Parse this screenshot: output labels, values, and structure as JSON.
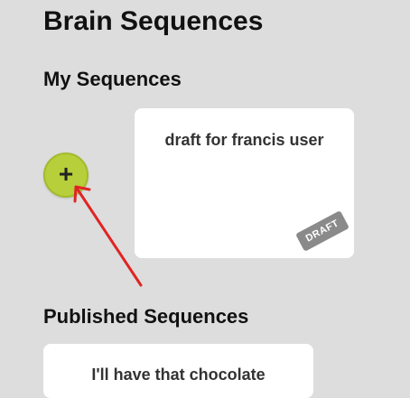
{
  "page": {
    "title": "Brain Sequences"
  },
  "my_sequences": {
    "heading": "My Sequences",
    "add_button_label": "+",
    "items": [
      {
        "title": "draft for francis user",
        "status": "DRAFT"
      }
    ]
  },
  "published_sequences": {
    "heading": "Published Sequences",
    "items": [
      {
        "title": "I'll have that chocolate"
      }
    ]
  },
  "colors": {
    "background": "#dddddd",
    "add_button": "#b6cf3a",
    "badge": "#8a8a8a",
    "annotation_arrow": "#e02424"
  }
}
